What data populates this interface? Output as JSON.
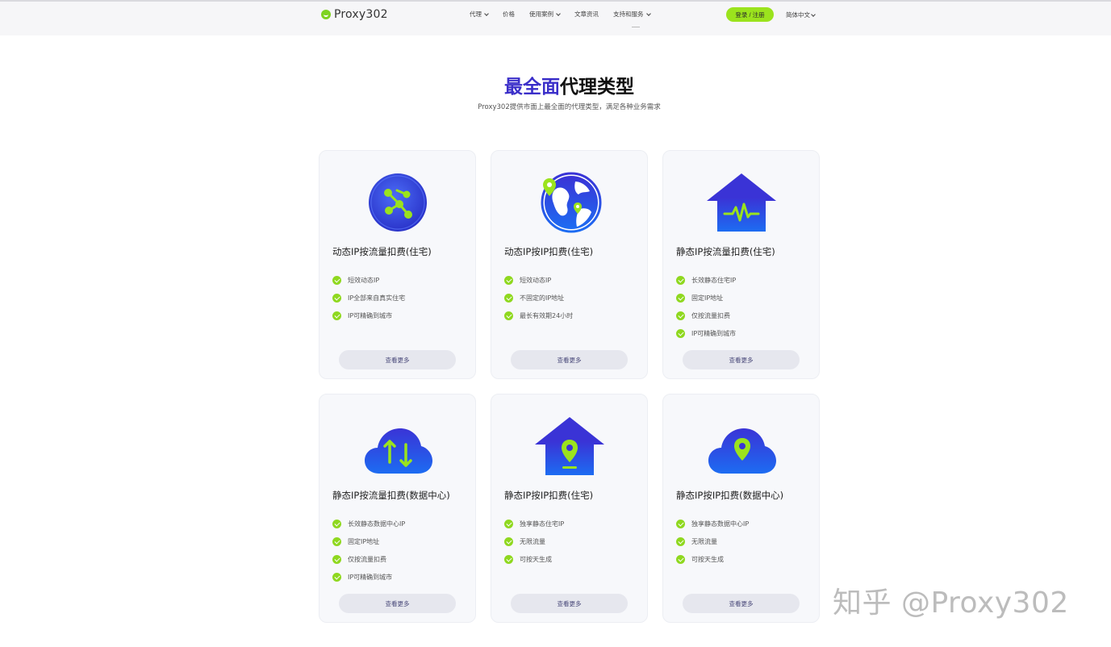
{
  "header": {
    "logo_text": "Proxy302",
    "menu": [
      {
        "label": "代理",
        "has_dropdown": true
      },
      {
        "label": "价格",
        "has_dropdown": false
      },
      {
        "label": "使用案例",
        "has_dropdown": true
      },
      {
        "label": "文章资讯",
        "has_dropdown": false
      },
      {
        "label": "支持和服务",
        "has_dropdown": true
      }
    ],
    "login_label": "登录 / 注册",
    "language": "简体中文"
  },
  "hero": {
    "title_highlight": "最全面",
    "title_rest": "代理类型",
    "subtitle": "Proxy302提供市面上最全面的代理类型，满足各种业务需求"
  },
  "cards": [
    {
      "icon": "globe-network-icon",
      "title": "动态IP按流量扣费(住宅)",
      "features": [
        "短效动态IP",
        "IP全部来自真实住宅",
        "IP可精确到城市"
      ],
      "button": "查看更多"
    },
    {
      "icon": "globe-location-icon",
      "title": "动态IP按IP扣费(住宅)",
      "features": [
        "短效动态IP",
        "不固定的IP地址",
        "最长有效期24小时"
      ],
      "button": "查看更多"
    },
    {
      "icon": "house-pulse-icon",
      "title": "静态IP按流量扣费(住宅)",
      "features": [
        "长效静态住宅IP",
        "固定IP地址",
        "仅按流量扣费",
        "IP可精确到城市"
      ],
      "button": "查看更多"
    },
    {
      "icon": "cloud-sync-icon",
      "title": "静态IP按流量扣费(数据中心)",
      "features": [
        "长效静态数据中心IP",
        "固定IP地址",
        "仅按流量扣费",
        "IP可精确到城市"
      ],
      "button": "查看更多"
    },
    {
      "icon": "house-location-icon",
      "title": "静态IP按IP扣费(住宅)",
      "features": [
        "独享静态住宅IP",
        "无限流量",
        "可按天生成"
      ],
      "button": "查看更多"
    },
    {
      "icon": "cloud-location-icon",
      "title": "静态IP按IP扣费(数据中心)",
      "features": [
        "独享静态数据中心IP",
        "无限流量",
        "可按天生成"
      ],
      "button": "查看更多"
    }
  ],
  "colors": {
    "accent_blue": "#3b2fc9",
    "accent_green": "#9be31d"
  },
  "watermark": "知乎 @Proxy302"
}
